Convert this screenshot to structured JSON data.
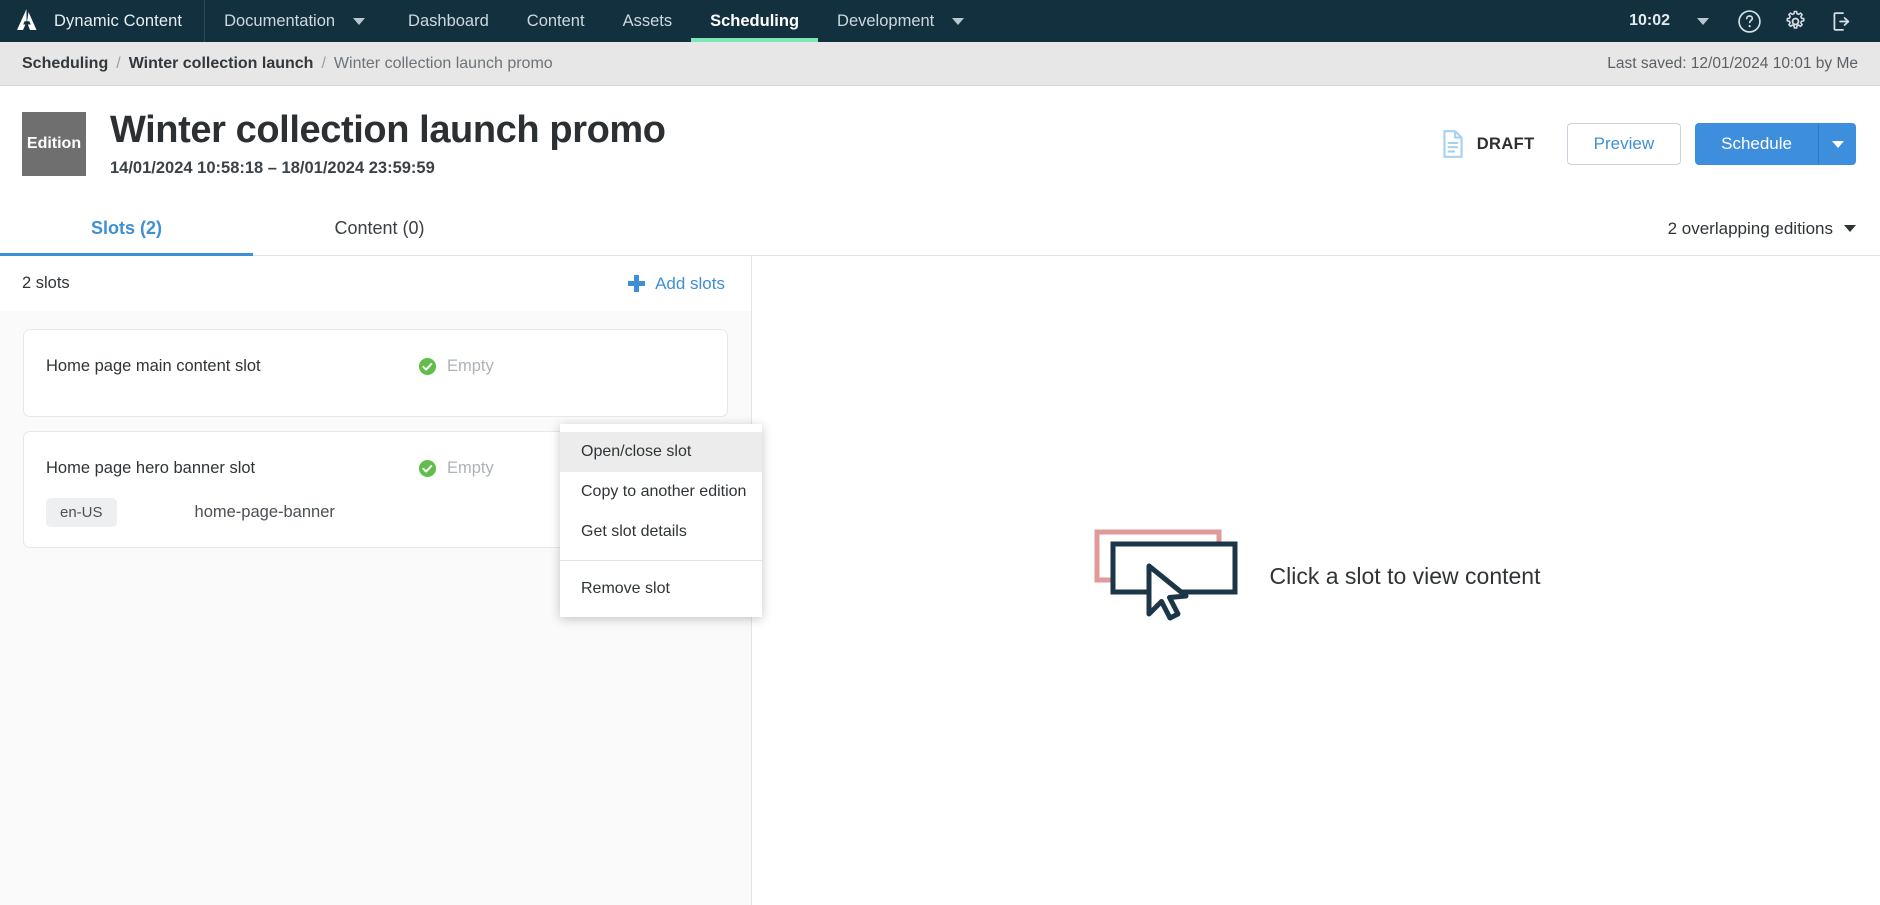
{
  "topnav": {
    "logo_icon": "dynamic-content-logo",
    "brand": "Dynamic Content",
    "items": [
      {
        "label": "Documentation",
        "has_caret": true,
        "active": false
      },
      {
        "label": "Dashboard",
        "has_caret": false,
        "active": false
      },
      {
        "label": "Content",
        "has_caret": false,
        "active": false
      },
      {
        "label": "Assets",
        "has_caret": false,
        "active": false
      },
      {
        "label": "Scheduling",
        "has_caret": false,
        "active": true
      },
      {
        "label": "Development",
        "has_caret": true,
        "active": false
      }
    ],
    "clock": "10:02",
    "clock_caret_icon": "chevron-down-icon",
    "help_icon": "help-circle-icon",
    "settings_icon": "gear-icon",
    "logout_icon": "logout-icon",
    "active_underline_color": "#7ee6b6",
    "background_color": "#13303f"
  },
  "breadcrumb": {
    "items": [
      {
        "label": "Scheduling",
        "current": false
      },
      {
        "label": "Winter collection launch",
        "current": false
      },
      {
        "label": "Winter collection launch promo",
        "current": true
      }
    ],
    "separator": "/",
    "last_saved": "Last saved: 12/01/2024 10:01 by Me"
  },
  "header": {
    "badge": "Edition",
    "title": "Winter collection launch promo",
    "dates": "14/01/2024 10:58:18 – 18/01/2024 23:59:59",
    "status_icon": "draft-document-icon",
    "status": "DRAFT",
    "preview_label": "Preview",
    "schedule_label": "Schedule",
    "schedule_caret_icon": "chevron-down-icon",
    "primary_color": "#3e8ede"
  },
  "tabs": {
    "items": [
      {
        "label": "Slots (2)",
        "active": true
      },
      {
        "label": "Content (0)",
        "active": false
      }
    ],
    "overlapping": "2 overlapping editions",
    "overlapping_caret_icon": "chevron-down-icon"
  },
  "slots_panel": {
    "count_label": "2 slots",
    "add_label": "Add slots",
    "add_icon": "plus-icon",
    "slots": [
      {
        "name": "Home page main content slot",
        "status_icon": "check-circle-icon",
        "status": "Empty",
        "locale": null,
        "meta": null
      },
      {
        "name": "Home page hero banner slot",
        "status_icon": "check-circle-icon",
        "status": "Empty",
        "locale": "en-US",
        "meta": "home-page-banner"
      }
    ],
    "status_icon_color": "#62be4a"
  },
  "context_menu": {
    "items": [
      {
        "label": "Open/close slot",
        "hover": true
      },
      {
        "label": "Copy to another edition",
        "hover": false
      },
      {
        "label": "Get slot details",
        "hover": false
      }
    ],
    "destructive": {
      "label": "Remove slot",
      "hover": false
    }
  },
  "empty_state": {
    "illustration_icon": "click-slot-cursor-illustration",
    "message": "Click a slot to view content",
    "accent_back_color": "#e09a9a",
    "accent_front_color": "#1b3647"
  }
}
